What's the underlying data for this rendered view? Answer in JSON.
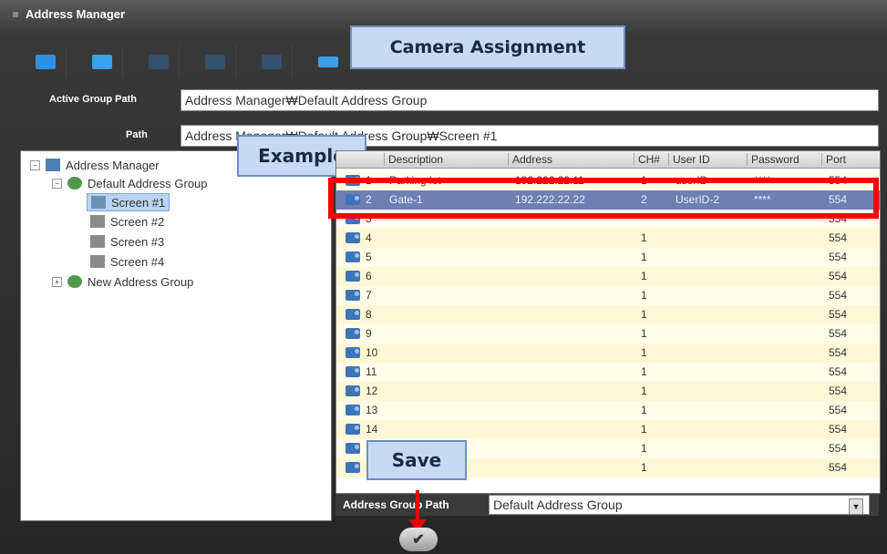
{
  "window": {
    "title": "Address Manager"
  },
  "callouts": {
    "camera_assignment": "Camera Assignment",
    "example": "Example",
    "save": "Save"
  },
  "toolbar": {
    "buttons": [
      {
        "icon": "monitor-icon",
        "color": "#2f8fe0"
      },
      {
        "icon": "add-monitor-icon",
        "color": "#3aa0e8"
      },
      {
        "icon": "disabled-icon-1",
        "color": "#3a5a7a"
      },
      {
        "icon": "disabled-icon-2",
        "color": "#3a5a7a"
      },
      {
        "icon": "disabled-icon-3",
        "color": "#3a5a7a"
      },
      {
        "icon": "camera-assign-icon",
        "color": "#3aa0e8"
      }
    ]
  },
  "paths": {
    "active_group_label": "Active Group Path",
    "active_group_value": "Address Manager₩Default Address Group",
    "path_label": "Path",
    "path_value": "Address Manager₩Default Address Group₩Screen #1"
  },
  "tree": {
    "root": "Address Manager",
    "default_group": "Default Address Group",
    "screens": [
      "Screen #1",
      "Screen #2",
      "Screen #3",
      "Screen #4"
    ],
    "new_group": "New Address Group"
  },
  "grid": {
    "headers": [
      "Description",
      "Address",
      "CH#",
      "User ID",
      "Password",
      "Port"
    ],
    "rows": [
      {
        "no": "1",
        "desc": "Parking lot",
        "addr": "192.222.22.11",
        "ch": "1",
        "user": "userID",
        "pw": "****",
        "port": "554"
      },
      {
        "no": "2",
        "desc": "Gate-1",
        "addr": "192.222.22.22",
        "ch": "2",
        "user": "UserID-2",
        "pw": "****",
        "port": "554"
      },
      {
        "no": "3",
        "desc": "",
        "addr": "",
        "ch": "",
        "user": "",
        "pw": "",
        "port": "554"
      },
      {
        "no": "4",
        "desc": "",
        "addr": "",
        "ch": "1",
        "user": "",
        "pw": "",
        "port": "554"
      },
      {
        "no": "5",
        "desc": "",
        "addr": "",
        "ch": "1",
        "user": "",
        "pw": "",
        "port": "554"
      },
      {
        "no": "6",
        "desc": "",
        "addr": "",
        "ch": "1",
        "user": "",
        "pw": "",
        "port": "554"
      },
      {
        "no": "7",
        "desc": "",
        "addr": "",
        "ch": "1",
        "user": "",
        "pw": "",
        "port": "554"
      },
      {
        "no": "8",
        "desc": "",
        "addr": "",
        "ch": "1",
        "user": "",
        "pw": "",
        "port": "554"
      },
      {
        "no": "9",
        "desc": "",
        "addr": "",
        "ch": "1",
        "user": "",
        "pw": "",
        "port": "554"
      },
      {
        "no": "10",
        "desc": "",
        "addr": "",
        "ch": "1",
        "user": "",
        "pw": "",
        "port": "554"
      },
      {
        "no": "11",
        "desc": "",
        "addr": "",
        "ch": "1",
        "user": "",
        "pw": "",
        "port": "554"
      },
      {
        "no": "12",
        "desc": "",
        "addr": "",
        "ch": "1",
        "user": "",
        "pw": "",
        "port": "554"
      },
      {
        "no": "13",
        "desc": "",
        "addr": "",
        "ch": "1",
        "user": "",
        "pw": "",
        "port": "554"
      },
      {
        "no": "14",
        "desc": "",
        "addr": "",
        "ch": "1",
        "user": "",
        "pw": "",
        "port": "554"
      },
      {
        "no": "",
        "desc": "",
        "addr": "",
        "ch": "1",
        "user": "",
        "pw": "",
        "port": "554"
      },
      {
        "no": "",
        "desc": "",
        "addr": "",
        "ch": "1",
        "user": "",
        "pw": "",
        "port": "554"
      }
    ]
  },
  "address_group_path": {
    "label": "Address Group Path",
    "value": "Default Address Group"
  },
  "save": {
    "icon": "check-icon",
    "glyph": "✔"
  }
}
